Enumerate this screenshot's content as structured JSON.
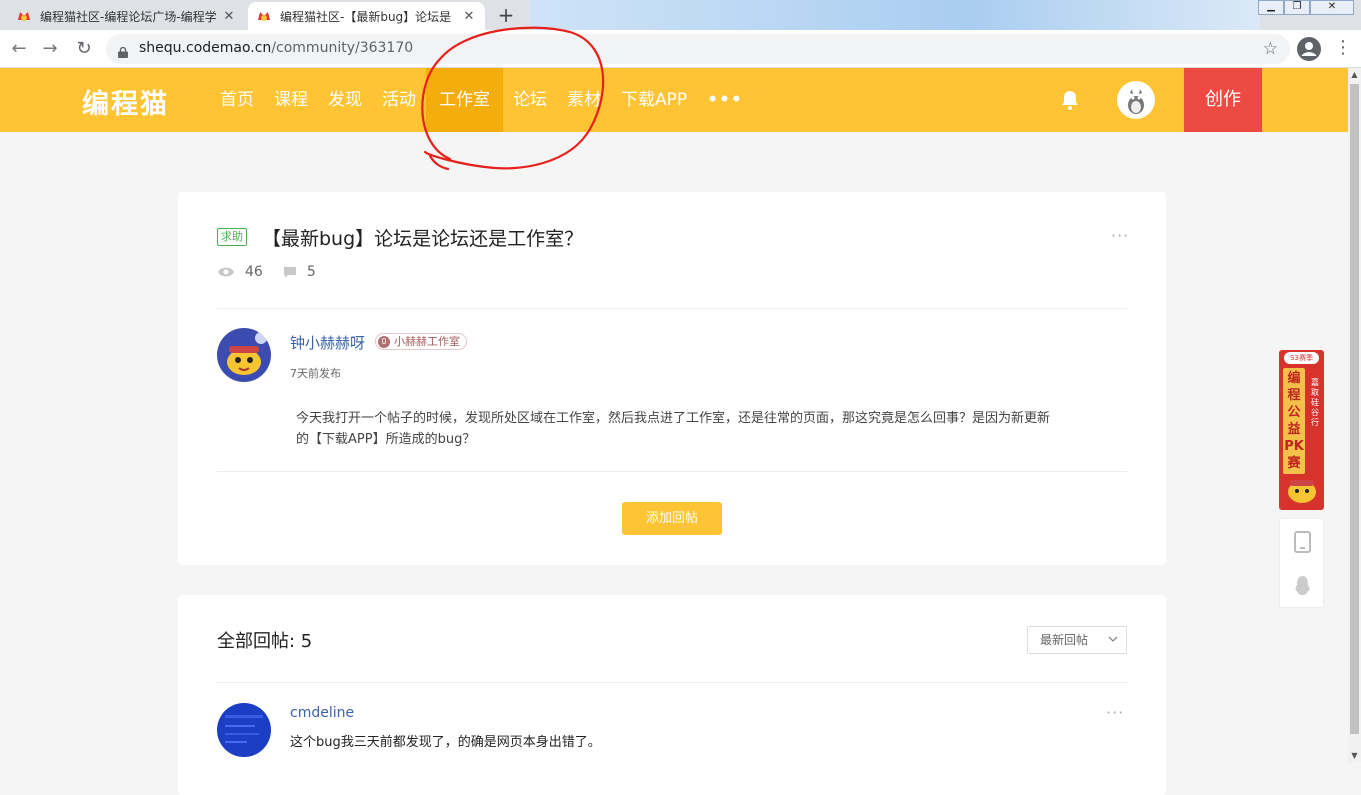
{
  "browser": {
    "tabs": [
      {
        "title": "编程猫社区-编程论坛广场-编程学"
      },
      {
        "title": "编程猫社区-【最新bug】论坛是"
      }
    ],
    "url_host": "shequ.codemao.cn",
    "url_path": "/community/363170"
  },
  "header": {
    "logo": "编程猫",
    "nav": [
      "首页",
      "课程",
      "发现",
      "活动",
      "工作室",
      "论坛",
      "素材",
      "下载APP"
    ],
    "more": "•••",
    "create": "创作",
    "accent": "#fec433",
    "active_nav": "工作室"
  },
  "post": {
    "tag": "求助",
    "title": "【最新bug】论坛是论坛还是工作室？",
    "views": "46",
    "comments": "5",
    "author": "钟小赫赫呀",
    "studio_badge_icon": "0",
    "studio": "小赫赫工作室",
    "time": "7天前发布",
    "body": "今天我打开一个帖子的时候，发现所处区域在工作室，然后我点进了工作室，还是往常的页面，那这究竟是怎么回事？是因为新更新的【下载APP】所造成的bug？",
    "reply_button": "添加回帖",
    "more": "···"
  },
  "replies": {
    "title": "全部回帖: 5",
    "sort": "最新回帖",
    "items": [
      {
        "author": "cmdeline",
        "text": "这个bug我三天前都发现了，的确是网页本身出错了。",
        "more": "···"
      }
    ]
  },
  "promo": {
    "season": "S3赛季",
    "main": "编程公益PK赛",
    "side": "嘉取硅谷行"
  }
}
